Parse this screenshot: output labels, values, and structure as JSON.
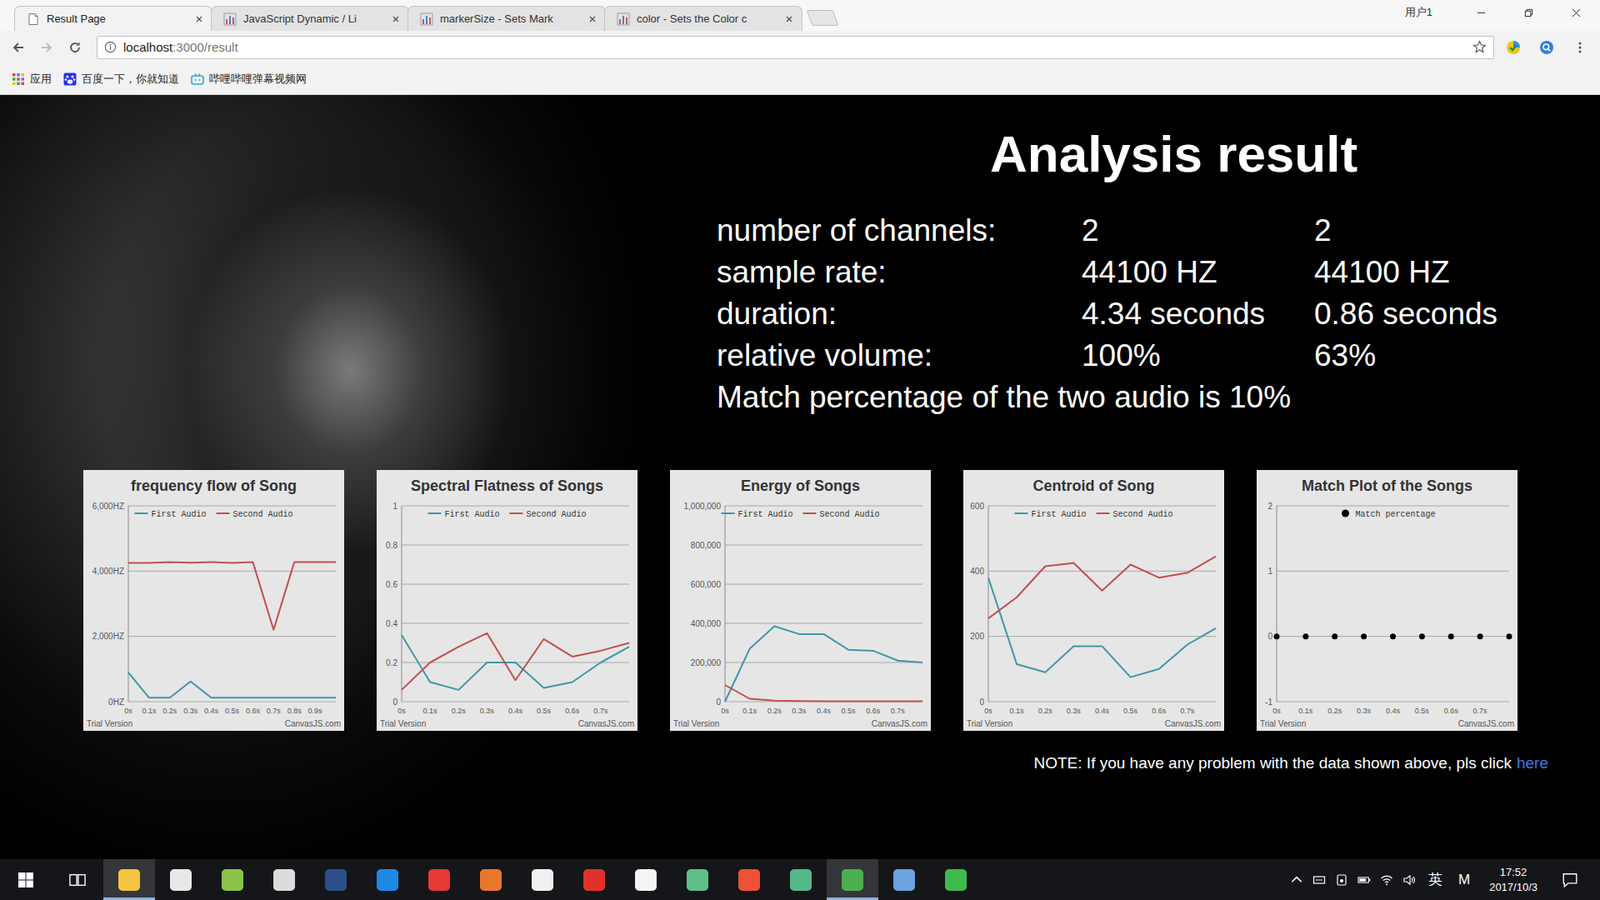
{
  "browser": {
    "tabs": [
      {
        "label": "Result Page",
        "selected": true,
        "kind": "page"
      },
      {
        "label": "JavaScript Dynamic / Li",
        "selected": false,
        "kind": "chart"
      },
      {
        "label": "markerSize - Sets Mark",
        "selected": false,
        "kind": "chart"
      },
      {
        "label": "color - Sets the Color c",
        "selected": false,
        "kind": "chart"
      }
    ],
    "profile": "用户1",
    "back_enabled": true,
    "forward_enabled": false,
    "address": {
      "host": "localhost",
      "path": ":3000/result"
    },
    "bookmarks": [
      {
        "label": "应用",
        "kind": "apps"
      },
      {
        "label": "百度一下，你就知道",
        "kind": "baidu"
      },
      {
        "label": "哔哩哔哩弹幕视频网",
        "kind": "bilibili"
      }
    ]
  },
  "page": {
    "title": "Analysis result",
    "stats": [
      {
        "label": "number of channels:",
        "first": "2",
        "second": "2"
      },
      {
        "label": "sample rate:",
        "first": "44100 HZ",
        "second": "44100 HZ"
      },
      {
        "label": "duration:",
        "first": "4.34 seconds",
        "second": "0.86 seconds"
      },
      {
        "label": "relative volume:",
        "first": "100%",
        "second": "63%"
      }
    ],
    "match_text": "Match percentage of the two audio is 10%",
    "charts": [
      {
        "title": "frequency flow of Song",
        "kind": "line",
        "y_min": 0,
        "y_max": 6000,
        "y_ticks": [
          "0HZ",
          "2,000HZ",
          "4,000HZ",
          "6,000HZ"
        ],
        "x_ticks": [
          "0s",
          "0.1s",
          "0.2s",
          "0.3s",
          "0.4s",
          "0.5s",
          "0.6s",
          "0.7s",
          "0.8s",
          "0.9s"
        ],
        "series": [
          {
            "name": "First Audio",
            "color": "#3f97a8",
            "values": [
              900,
              120,
              120,
              620,
              120,
              120,
              120,
              120,
              120,
              120,
              120
            ]
          },
          {
            "name": "Second Audio",
            "color": "#c0504d",
            "values": [
              4250,
              4250,
              4280,
              4260,
              4280,
              4250,
              4280,
              2200,
              4280,
              4280,
              4280
            ]
          }
        ],
        "watermark": "Trial Version",
        "credit": "CanvasJS.com"
      },
      {
        "title": "Spectral Flatness of Songs",
        "kind": "line",
        "y_min": 0,
        "y_max": 1,
        "y_ticks": [
          "0",
          "0.2",
          "0.4",
          "0.6",
          "0.8",
          "1"
        ],
        "x_ticks": [
          "0s",
          "0.1s",
          "0.2s",
          "0.3s",
          "0.4s",
          "0.5s",
          "0.6s",
          "0.7s"
        ],
        "series": [
          {
            "name": "First Audio",
            "color": "#3f97a8",
            "values": [
              0.34,
              0.1,
              0.06,
              0.2,
              0.2,
              0.07,
              0.1,
              0.2,
              0.28
            ]
          },
          {
            "name": "Second Audio",
            "color": "#c0504d",
            "values": [
              0.06,
              0.2,
              0.28,
              0.35,
              0.11,
              0.32,
              0.23,
              0.26,
              0.3
            ]
          }
        ],
        "watermark": "Trial Version",
        "credit": "CanvasJS.com"
      },
      {
        "title": "Energy of Songs",
        "kind": "line",
        "y_min": 0,
        "y_max": 1000000,
        "y_ticks": [
          "0",
          "200,000",
          "400,000",
          "600,000",
          "800,000",
          "1,000,000"
        ],
        "x_ticks": [
          "0s",
          "0.1s",
          "0.2s",
          "0.3s",
          "0.4s",
          "0.5s",
          "0.6s",
          "0.7s"
        ],
        "series": [
          {
            "name": "First Audio",
            "color": "#3f97a8",
            "values": [
              0,
              270000,
              385000,
              345000,
              345000,
              265000,
              260000,
              210000,
              200000
            ]
          },
          {
            "name": "Second Audio",
            "color": "#c0504d",
            "values": [
              85000,
              15000,
              5000,
              3000,
              2000,
              2000,
              2000,
              2000,
              2000
            ]
          }
        ],
        "watermark": "Trial Version",
        "credit": "CanvasJS.com"
      },
      {
        "title": "Centroid of Song",
        "kind": "line",
        "y_min": 0,
        "y_max": 600,
        "y_ticks": [
          "0",
          "200",
          "400",
          "600"
        ],
        "x_ticks": [
          "0s",
          "0.1s",
          "0.2s",
          "0.3s",
          "0.4s",
          "0.5s",
          "0.6s",
          "0.7s"
        ],
        "series": [
          {
            "name": "First Audio",
            "color": "#3f97a8",
            "values": [
              380,
              115,
              90,
              170,
              170,
              75,
              100,
              175,
              225
            ]
          },
          {
            "name": "Second Audio",
            "color": "#c0504d",
            "values": [
              255,
              320,
              415,
              425,
              340,
              420,
              380,
              395,
              445
            ]
          }
        ],
        "watermark": "Trial Version",
        "credit": "CanvasJS.com"
      },
      {
        "title": "Match Plot of the Songs",
        "kind": "scatter",
        "y_min": -1,
        "y_max": 2,
        "y_ticks": [
          "-1",
          "0",
          "1",
          "2"
        ],
        "x_ticks": [
          "0s",
          "0.1s",
          "0.2s",
          "0.3s",
          "0.4s",
          "0.5s",
          "0.6s",
          "0.7s"
        ],
        "series": [
          {
            "name": "Match percentage",
            "color": "#000000",
            "values": [
              0,
              0,
              0,
              0,
              0,
              0,
              0,
              0,
              0
            ]
          }
        ],
        "watermark": "Trial Version",
        "credit": "CanvasJS.com"
      }
    ],
    "note": {
      "text": "NOTE: If you have any problem with the data shown above, pls click",
      "link": "here"
    }
  },
  "taskbar": {
    "apps": [
      {
        "color": "#f4c542",
        "active": true
      },
      {
        "color": "#e8e8e8",
        "active": false
      },
      {
        "color": "#8bc34a",
        "active": false
      },
      {
        "color": "#dcdcdc",
        "active": false
      },
      {
        "color": "#2b4f8a",
        "active": false
      },
      {
        "color": "#1e88e5",
        "active": false
      },
      {
        "color": "#e53935",
        "active": false
      },
      {
        "color": "#e8772e",
        "active": false
      },
      {
        "color": "#f0f0f0",
        "active": false
      },
      {
        "color": "#e0322b",
        "active": false
      },
      {
        "color": "#f5f5f5",
        "active": false
      },
      {
        "color": "#5fbf88",
        "active": false
      },
      {
        "color": "#f05033",
        "active": false
      },
      {
        "color": "#53b98a",
        "active": false
      },
      {
        "color": "#4caf50",
        "active": true
      },
      {
        "color": "#6aa3e0",
        "active": false
      },
      {
        "color": "#3dba4e",
        "active": false
      }
    ],
    "tray": {
      "language": "英",
      "ime": "M",
      "time": "17:52",
      "date": "2017/10/3"
    }
  }
}
